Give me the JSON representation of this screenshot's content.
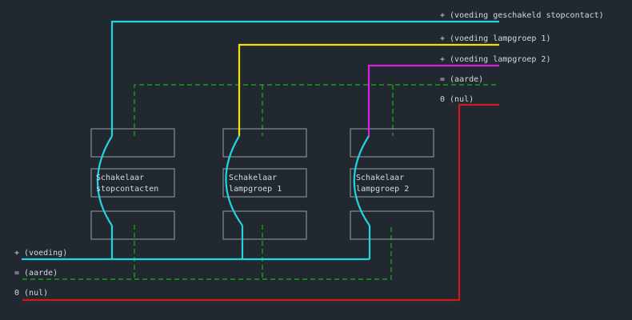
{
  "diagram": {
    "labels": {
      "voeding_geschakeld": "+ (voeding geschakeld stopcontact)",
      "voeding_lampgroep_1": "+ (voeding lampgroep 1)",
      "voeding_lampgroep_2": "+ (voeding lampgroep 2)",
      "aarde_top": "= (aarde)",
      "nul_top": "0 (nul)",
      "voeding_in": "+ (voeding)",
      "aarde_in": "= (aarde)",
      "nul_in": "0 (nul)"
    },
    "switches": [
      {
        "line1": "Schakelaar",
        "line2": "stopcontacten"
      },
      {
        "line1": "Schakelaar",
        "line2": "lampgroep 1"
      },
      {
        "line1": "Schakelaar",
        "line2": "lampgroep 2"
      }
    ],
    "colors": {
      "background": "#212830",
      "feed": "#22d3e0",
      "lampgroep_1": "#f0e20a",
      "lampgroep_2": "#dd1fe0",
      "earth": "#16b516",
      "neutral": "#d21a1a",
      "box": "#9aa0a6",
      "text": "#d6d9dd"
    }
  }
}
